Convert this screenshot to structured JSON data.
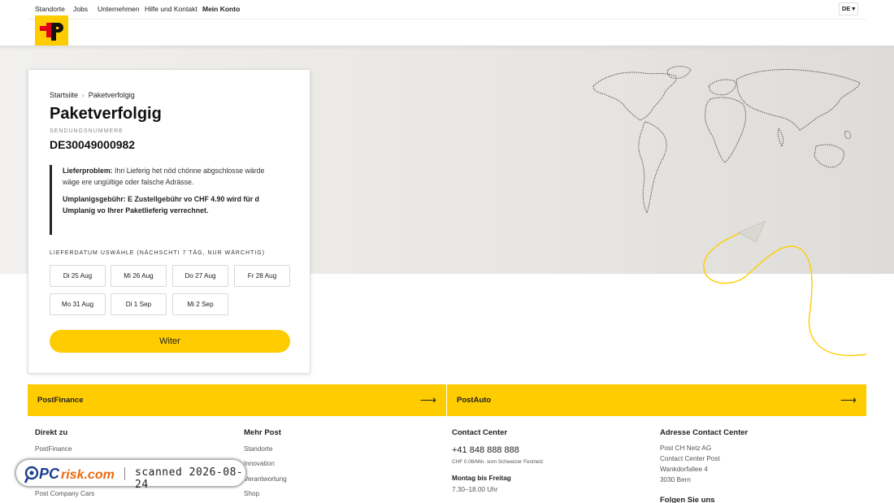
{
  "topnav": {
    "items": [
      "Standorte",
      "Jobs",
      "Unternehmen",
      "Hilfe und Kontakt",
      "Mein Konto"
    ],
    "lang": "DE ▾"
  },
  "card": {
    "breadcrumb": [
      "Startsiite",
      "Paketverfolgig"
    ],
    "breadcrumb_sep": "›",
    "title": "Paketverfolgig",
    "tracking_label": "SENDUNGSNUMMERE",
    "tracking_number": "DE30049000982",
    "alert": {
      "problem_label": "Lieferproblem:",
      "problem_text": " Ihri Lieferig het nöd chönne abgschlosse wärde wäge ere ungültige oder falsche Adrässe.",
      "fee_text": "Umplanigsgebühr: E Zustellgebühr vo CHF 4.90 wird für d Umplanig vo Ihrer Paketlieferig verrechnet."
    },
    "date_label": "LIEFERDATUM USWÄHLE (NÄCHSCHTI 7 TÄG, NUR WÄRCHTIG)",
    "dates": [
      "Di 25 Aug",
      "Mi 26 Aug",
      "Do 27 Aug",
      "Fr 28 Aug",
      "Mo 31 Aug",
      "Di 1 Sep",
      "Mi 2 Sep"
    ],
    "submit": "Witer"
  },
  "banners": [
    {
      "label": "PostFinance",
      "arrow": "⟶"
    },
    {
      "label": "PostAuto",
      "arrow": "⟶"
    }
  ],
  "footer": {
    "direkt": {
      "title": "Direkt zu",
      "links": [
        "PostFinance",
        "",
        "",
        "Post Company Cars"
      ]
    },
    "mehr": {
      "title": "Mehr Post",
      "links": [
        "Standorte",
        "Innovation",
        "Verantwortung",
        "Shop"
      ]
    },
    "contact": {
      "title": "Contact Center",
      "phone": "+41 848 888 888",
      "rate": "CHF 0.08/Min. vom Schweizer Festnetz",
      "hours_label": "Montag bis Freitag",
      "hours": "7.30–18.00 Uhr"
    },
    "address": {
      "title": "Adresse Contact Center",
      "lines": [
        "Post CH Netz AG",
        "Contact Center Post",
        "Wankdorfallee 4",
        "3030 Bern"
      ],
      "follow": "Folgen Sie uns"
    }
  },
  "watermark": {
    "brand": "PCrisk.com",
    "text": "scanned 2026-08-24"
  },
  "colors": {
    "accent": "#ffcc00",
    "logo_red": "#e2001a"
  }
}
